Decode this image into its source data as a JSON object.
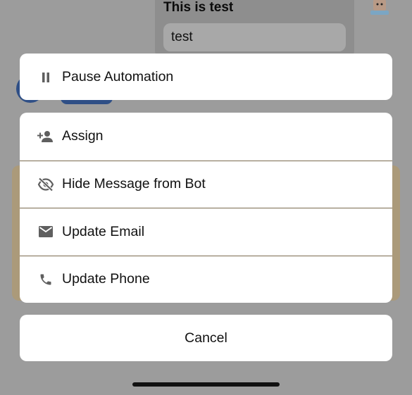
{
  "background": {
    "bubble_title": "This is test",
    "bubble_field_value": "test",
    "dots": "·········"
  },
  "sheet": {
    "top_item": {
      "label": "Pause Automation",
      "icon": "pause-icon"
    },
    "items": [
      {
        "label": "Assign",
        "icon": "person-add-icon"
      },
      {
        "label": "Hide Message from Bot",
        "icon": "eye-off-icon"
      },
      {
        "label": "Update Email",
        "icon": "mail-icon"
      },
      {
        "label": "Update Phone",
        "icon": "phone-icon"
      }
    ],
    "cancel_label": "Cancel"
  },
  "colors": {
    "overlay": "#9c9c9c",
    "sheet_bg": "#ffffff",
    "icon": "#5f5f5f",
    "accent_blue": "#2f4f86"
  }
}
